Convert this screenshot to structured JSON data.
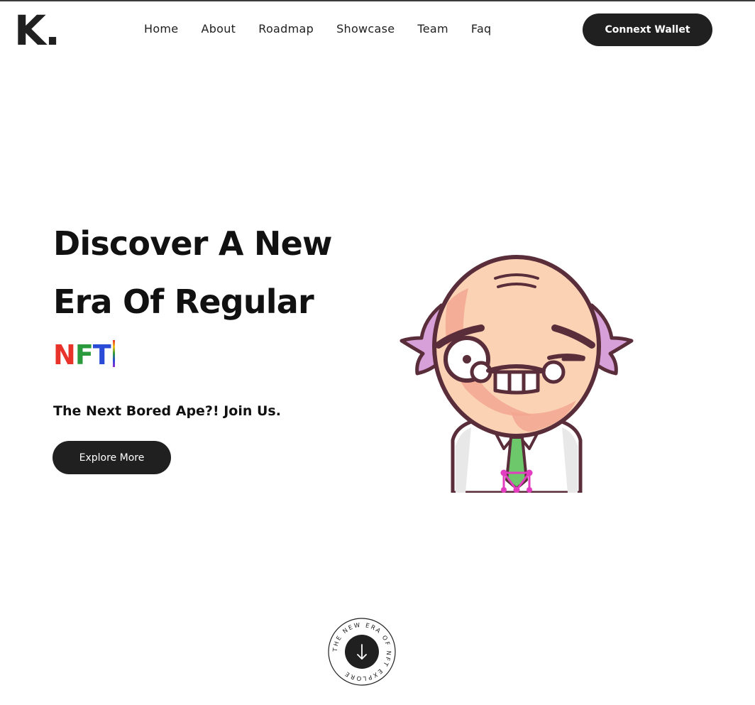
{
  "header": {
    "logo": "K.",
    "nav": [
      "Home",
      "About",
      "Roadmap",
      "Showcase",
      "Team",
      "Faq"
    ],
    "wallet_button": "Connext Wallet"
  },
  "hero": {
    "title_line1": "Discover A New",
    "title_line2": "Era Of Regular",
    "typed_letters": [
      "N",
      "F",
      "T"
    ],
    "subtitle": "The Next Bored Ape?! Join Us.",
    "explore_button": "Explore More"
  },
  "scroll_badge": {
    "circular_text": "THE NEW ERA OF NFT EXPLORE",
    "arrow_icon": "arrow-down-icon"
  },
  "colors": {
    "dark": "#202020",
    "rainbow": [
      "#e8322a",
      "#f3c21a",
      "#2a9a3c",
      "#2a4bd6",
      "#9a2ad6"
    ]
  }
}
